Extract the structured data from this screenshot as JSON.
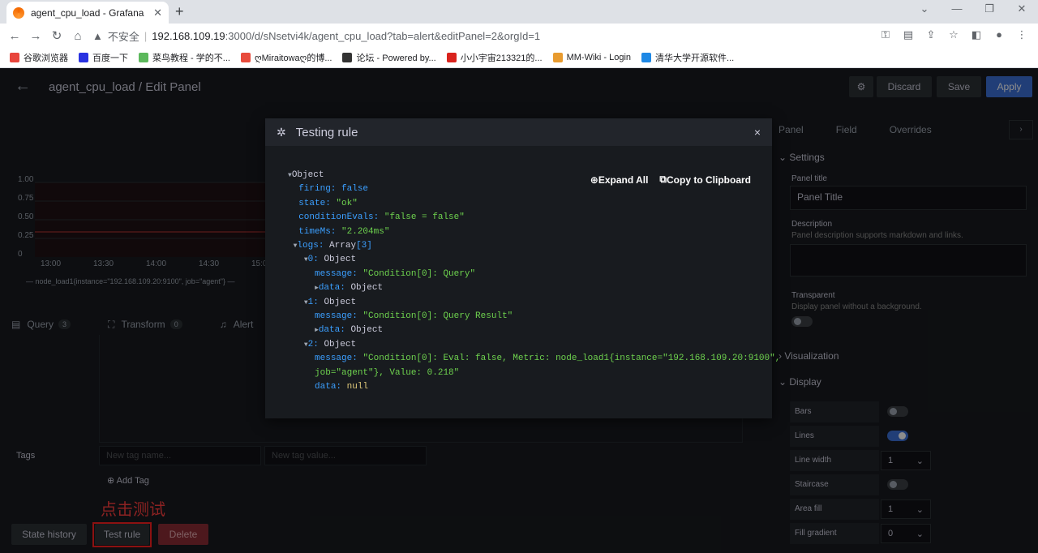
{
  "browser": {
    "tab_title": "agent_cpu_load - Grafana",
    "tab_close": "✕",
    "new_tab": "+",
    "insecure_label": "不安全",
    "url_host": "192.168.109.19",
    "url_rest": ":3000/d/sNsetvi4k/agent_cpu_load?tab=alert&editPanel=2&orgId=1",
    "bookmarks": [
      {
        "label": "谷歌浏览器",
        "color": "#e8453c"
      },
      {
        "label": "百度一下",
        "color": "#2932e1"
      },
      {
        "label": "菜鸟教程 - 学的不...",
        "color": "#5cb85c"
      },
      {
        "label": "ღMiraitowaღ的博...",
        "color": "#e84b3c"
      },
      {
        "label": "论坛 - Powered by...",
        "color": "#333333"
      },
      {
        "label": "小小宇宙213321的...",
        "color": "#d9231d"
      },
      {
        "label": "MM-Wiki - Login",
        "color": "#e89b2f"
      },
      {
        "label": "清华大学开源软件...",
        "color": "#1e88e5"
      }
    ]
  },
  "topnav": {
    "breadcrumb": "agent_cpu_load / Edit Panel",
    "discard": "Discard",
    "save": "Save",
    "apply": "Apply"
  },
  "graph": {
    "y_ticks": [
      "1.00",
      "0.75",
      "0.50",
      "0.25",
      "0"
    ],
    "x_ticks": [
      "13:00",
      "13:30",
      "14:00",
      "14:30",
      "15:0"
    ],
    "legend": "— node_load1{instance=\"192.168.109.20:9100\", job=\"agent\"}  —"
  },
  "query_tabs": [
    {
      "label": "Query",
      "count": "3"
    },
    {
      "label": "Transform",
      "count": "0"
    },
    {
      "label": "Alert",
      "count": ""
    }
  ],
  "tags": {
    "label": "Tags",
    "name_placeholder": "New tag name...",
    "value_placeholder": "New tag value...",
    "add_tag": "Add Tag"
  },
  "annotation_note": "点击测试",
  "bottom_buttons": {
    "state_history": "State history",
    "test_rule": "Test rule",
    "delete": "Delete"
  },
  "options": {
    "tabs": [
      "Panel",
      "Field",
      "Overrides"
    ],
    "settings": "Settings",
    "panel_title_label": "Panel title",
    "panel_title_value": "Panel Title",
    "description_label": "Description",
    "description_hint": "Panel description supports markdown and links.",
    "transparent_label": "Transparent",
    "transparent_hint": "Display panel without a background.",
    "visualization": "Visualization",
    "display": "Display",
    "rows": [
      {
        "label": "Bars",
        "type": "switch",
        "on": false
      },
      {
        "label": "Lines",
        "type": "switch",
        "on": true
      },
      {
        "label": "Line width",
        "type": "select",
        "value": "1"
      },
      {
        "label": "Staircase",
        "type": "switch",
        "on": false
      },
      {
        "label": "Area fill",
        "type": "select",
        "value": "1"
      },
      {
        "label": "Fill gradient",
        "type": "select",
        "value": "0"
      }
    ]
  },
  "modal": {
    "title": "Testing rule",
    "close": "×",
    "expand_all": "Expand All",
    "copy": "Copy to Clipboard",
    "root": "Object",
    "firing_key": "firing:",
    "firing_val": "false",
    "state_key": "state:",
    "state_val": "\"ok\"",
    "cond_key": "conditionEvals:",
    "cond_val": "\"false = false\"",
    "time_key": "timeMs:",
    "time_val": "\"2.204ms\"",
    "logs_key": "logs:",
    "logs_type": "Array",
    "logs_len": "[3]",
    "log0_idx": "0:",
    "log0_msg": "\"Condition[0]: Query\"",
    "log1_idx": "1:",
    "log1_msg": "\"Condition[0]: Query Result\"",
    "log2_idx": "2:",
    "log2_msg_a": "\"Condition[0]: Eval: false, Metric: node_load1{instance=\"192.168.109.20:9100\",",
    "log2_msg_b": "job=\"agent\"}, Value: 0.218\"",
    "message_key": "message:",
    "data_key": "data:",
    "object": "Object",
    "null_val": "null"
  }
}
